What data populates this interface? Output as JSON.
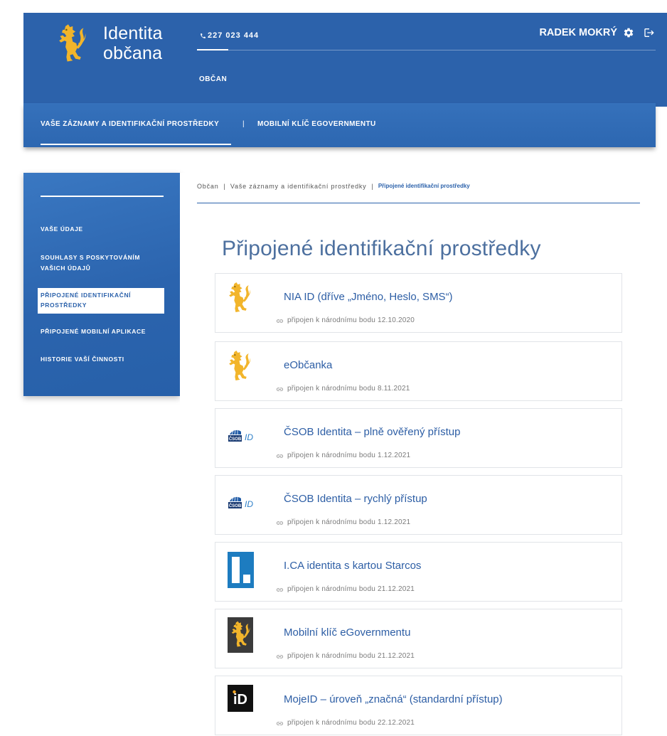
{
  "colors": {
    "primary": "#2c62ab",
    "accent_yellow": "#f2b52b",
    "title": "#4d709f",
    "link": "#2d5ea5",
    "muted": "#7b7b7b"
  },
  "header": {
    "brand": {
      "line1": "Identita",
      "line2": "občana"
    },
    "phone": "227 023 444",
    "role_tab": "OBČAN",
    "user_name": "RADEK MOKRÝ",
    "icons": {
      "logo": "lion-logo-icon",
      "phone": "phone-icon",
      "settings": "gear-icon",
      "logout": "logout-icon"
    }
  },
  "nav": {
    "items": [
      {
        "label": "VAŠE ZÁZNAMY A IDENTIFIKAČNÍ PROSTŘEDKY",
        "active": true
      },
      {
        "label": "MOBILNÍ KLÍČ EGOVERNMENTU",
        "active": false
      }
    ],
    "separator": "|"
  },
  "sidebar": {
    "items": [
      {
        "lines": [
          "VAŠE ÚDAJE"
        ],
        "active": false
      },
      {
        "lines": [
          "SOUHLASY S POSKYTOVÁNÍM",
          "VAŠICH ÚDAJŮ"
        ],
        "active": false
      },
      {
        "lines": [
          "PŘIPOJENÉ IDENTIFIKAČNÍ",
          "PROSTŘEDKY"
        ],
        "active": true
      },
      {
        "lines": [
          "PŘIPOJENÉ MOBILNÍ APLIKACE"
        ],
        "active": false
      },
      {
        "lines": [
          "HISTORIE VAŠÍ ČINNOSTI"
        ],
        "active": false
      }
    ]
  },
  "breadcrumb": {
    "items": [
      "Občan",
      "Vaše záznamy a identifikační prostředky",
      "Připojené identifikační prostředky"
    ],
    "separator": "|"
  },
  "page_title": "Připojené identifikační prostředky",
  "status_icon": "link-icon",
  "providers": [
    {
      "name": "NIA ID (dříve „Jméno, Heslo, SMS“)",
      "status": "připojen k národnímu bodu 12.10.2020",
      "logo": "lion-icon"
    },
    {
      "name": "eObčanka",
      "status": "připojen k národnímu bodu 8.11.2021",
      "logo": "lion-icon"
    },
    {
      "name": "ČSOB Identita – plně ověřený přístup",
      "status": "připojen k národnímu bodu 1.12.2021",
      "logo": "csob-id-logo",
      "logo_text": [
        "ČSOB",
        "ID"
      ]
    },
    {
      "name": "ČSOB Identita – rychlý přístup",
      "status": "připojen k národnímu bodu 1.12.2021",
      "logo": "csob-id-logo",
      "logo_text": [
        "ČSOB",
        "ID"
      ]
    },
    {
      "name": "I.CA identita s kartou Starcos",
      "status": "připojen k národnímu bodu 21.12.2021",
      "logo": "ica-logo"
    },
    {
      "name": "Mobilní klíč eGovernmentu",
      "status": "připojen k národnímu bodu 21.12.2021",
      "logo": "mobile-key-logo"
    },
    {
      "name": "MojeID – úroveň „značná“ (standardní přístup)",
      "status": "připojen k národnímu bodu 22.12.2021",
      "logo": "mojeid-logo",
      "logo_text": "iD"
    }
  ]
}
